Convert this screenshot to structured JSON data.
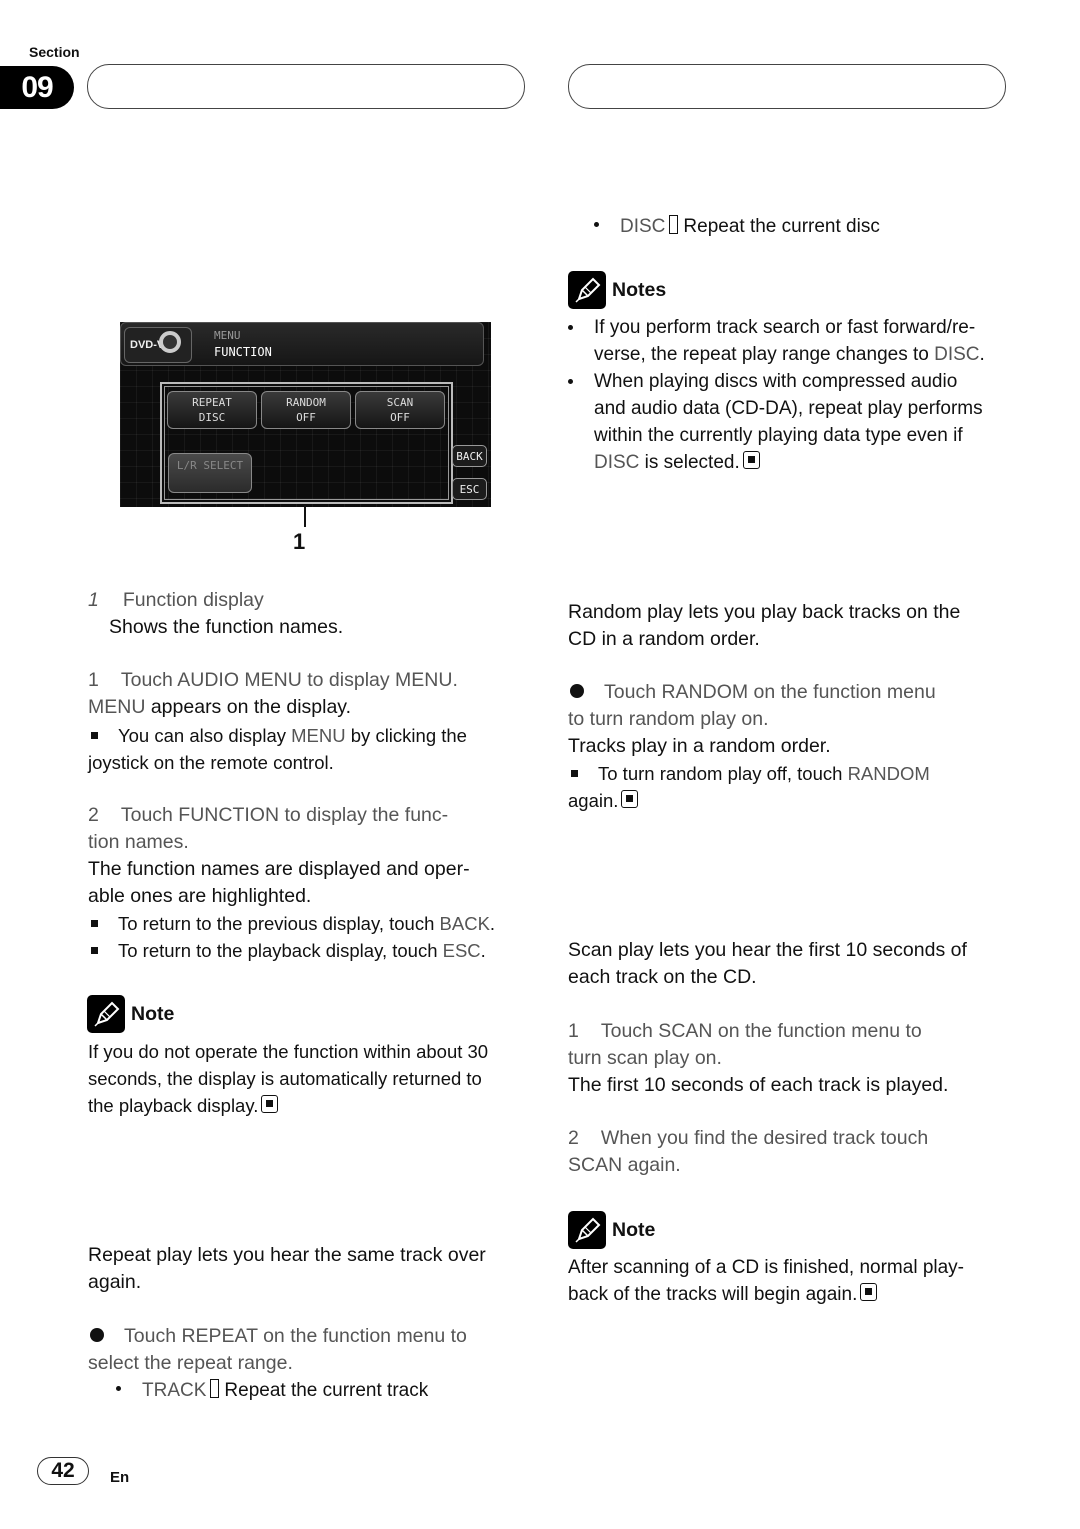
{
  "header": {
    "section_label": "Section",
    "section_number": "09",
    "left_title": "",
    "right_title": ""
  },
  "screen": {
    "logo": "DVD-V",
    "menu_label": "MENU",
    "function_label": "FUNCTION",
    "buttons": [
      {
        "line1": "REPEAT",
        "line2": "DISC"
      },
      {
        "line1": "RANDOM",
        "line2": "OFF"
      },
      {
        "line1": "SCAN",
        "line2": "OFF"
      }
    ],
    "lr_select": "L/R SELECT",
    "back": "BACK",
    "esc": "ESC",
    "callout": "1"
  },
  "left": {
    "caption_num": "1",
    "caption_title": "Function display",
    "caption_desc": "Shows the function names.",
    "step1": {
      "num": "1",
      "text": "Touch AUDIO MENU to display MENU."
    },
    "step1_result_caps": "MENU",
    "step1_result": " appears on the display.",
    "step1_tip_pre": "You can also display ",
    "step1_tip_caps": "MENU",
    "step1_tip_post": " by clicking the joystick on the remote control.",
    "step2": {
      "num": "2",
      "text_a": "Touch FUNCTION to display the func-",
      "text_b": "tion names."
    },
    "step2_result_a": "The function names are displayed and oper-",
    "step2_result_b": "able ones are highlighted.",
    "tip_back_pre": "To return to the previous display, touch ",
    "tip_back_caps": "BACK",
    "tip_esc_pre": "To return to the playback display, touch ",
    "tip_esc_caps": "ESC",
    "note_title": "Note",
    "note_text_a": "If you do not operate the function within about 30",
    "note_text_b": "seconds, the display is automatically returned to",
    "note_text_c": "the playback display.",
    "repeat_intro_a": "Repeat play lets you hear the same track over",
    "repeat_intro_b": "again.",
    "repeat_step_a": "Touch REPEAT on the function menu to",
    "repeat_step_b": "select the repeat range.",
    "track_caps": "TRACK",
    "track_desc": "Repeat the current track"
  },
  "right": {
    "disc_caps": "DISC",
    "disc_desc": "Repeat the current disc",
    "notes_title": "Notes",
    "note1_a": "If you perform track search or fast forward/re-",
    "note1_b_pre": "verse, the repeat play range changes to ",
    "note1_b_caps": "DISC",
    "note2_a": "When playing discs with compressed audio",
    "note2_b": "and audio data (CD-DA), repeat play performs",
    "note2_c": "within the currently playing data type even if",
    "note2_d_caps": "DISC",
    "note2_d_post": " is selected.",
    "random_intro_a": "Random play lets you play back tracks on the",
    "random_intro_b": "CD in a random order.",
    "random_step_a": "Touch RANDOM on the function menu",
    "random_step_b": "to turn random play on.",
    "random_result": "Tracks play in a random order.",
    "random_tip_pre": "To turn random play off, touch ",
    "random_tip_caps": "RANDOM",
    "random_tip_post": "again.",
    "scan_intro_a": "Scan play lets you hear the first 10 seconds of",
    "scan_intro_b": "each track on the CD.",
    "scan_step1": {
      "num": "1",
      "text_a": "Touch SCAN on the function menu to",
      "text_b": "turn scan play on."
    },
    "scan_result": "The first 10 seconds of each track is played.",
    "scan_step2": {
      "num": "2",
      "text_a": "When you find the desired track touch",
      "text_b": "SCAN again."
    },
    "note_title": "Note",
    "note_a": "After scanning of a CD is finished, normal play-",
    "note_b": "back of the tracks will begin again."
  },
  "footer": {
    "page_number": "42",
    "language": "En"
  }
}
